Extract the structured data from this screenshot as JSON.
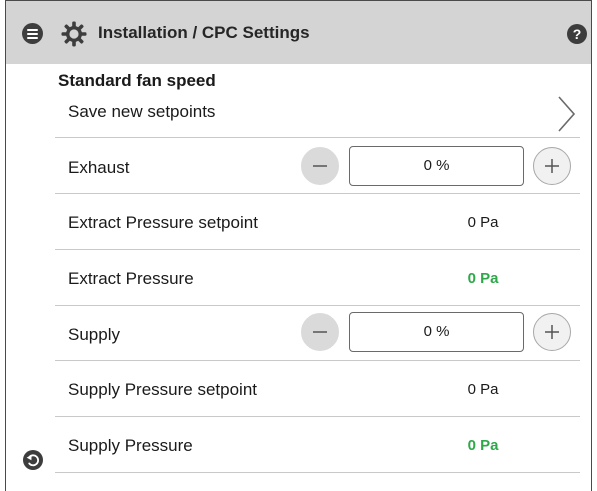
{
  "header": {
    "title": "Installation / CPC Settings",
    "help_label": "?"
  },
  "section_title": "Standard fan speed",
  "save_label": "Save new setpoints",
  "rows": {
    "exhaust": {
      "label": "Exhaust",
      "value": "0 %"
    },
    "extract_setpoint": {
      "label": "Extract Pressure setpoint",
      "value": "0 Pa"
    },
    "extract_pressure": {
      "label": "Extract Pressure",
      "value": "0 Pa"
    },
    "supply": {
      "label": "Supply",
      "value": "0 %"
    },
    "supply_setpoint": {
      "label": "Supply Pressure setpoint",
      "value": "0 Pa"
    },
    "supply_pressure": {
      "label": "Supply Pressure",
      "value": "0 Pa"
    }
  },
  "colors": {
    "header_bg": "#d4d4d4",
    "icon_dark": "#3d3d3d",
    "live_value": "#2fa84a",
    "divider": "#c9c9c9"
  },
  "icons": {
    "menu": "menu-icon",
    "settings": "gear-icon",
    "help": "help-icon",
    "navigate": "chevron-right-icon",
    "decrease": "minus-icon",
    "increase": "plus-icon",
    "back": "back-arrow-icon"
  }
}
